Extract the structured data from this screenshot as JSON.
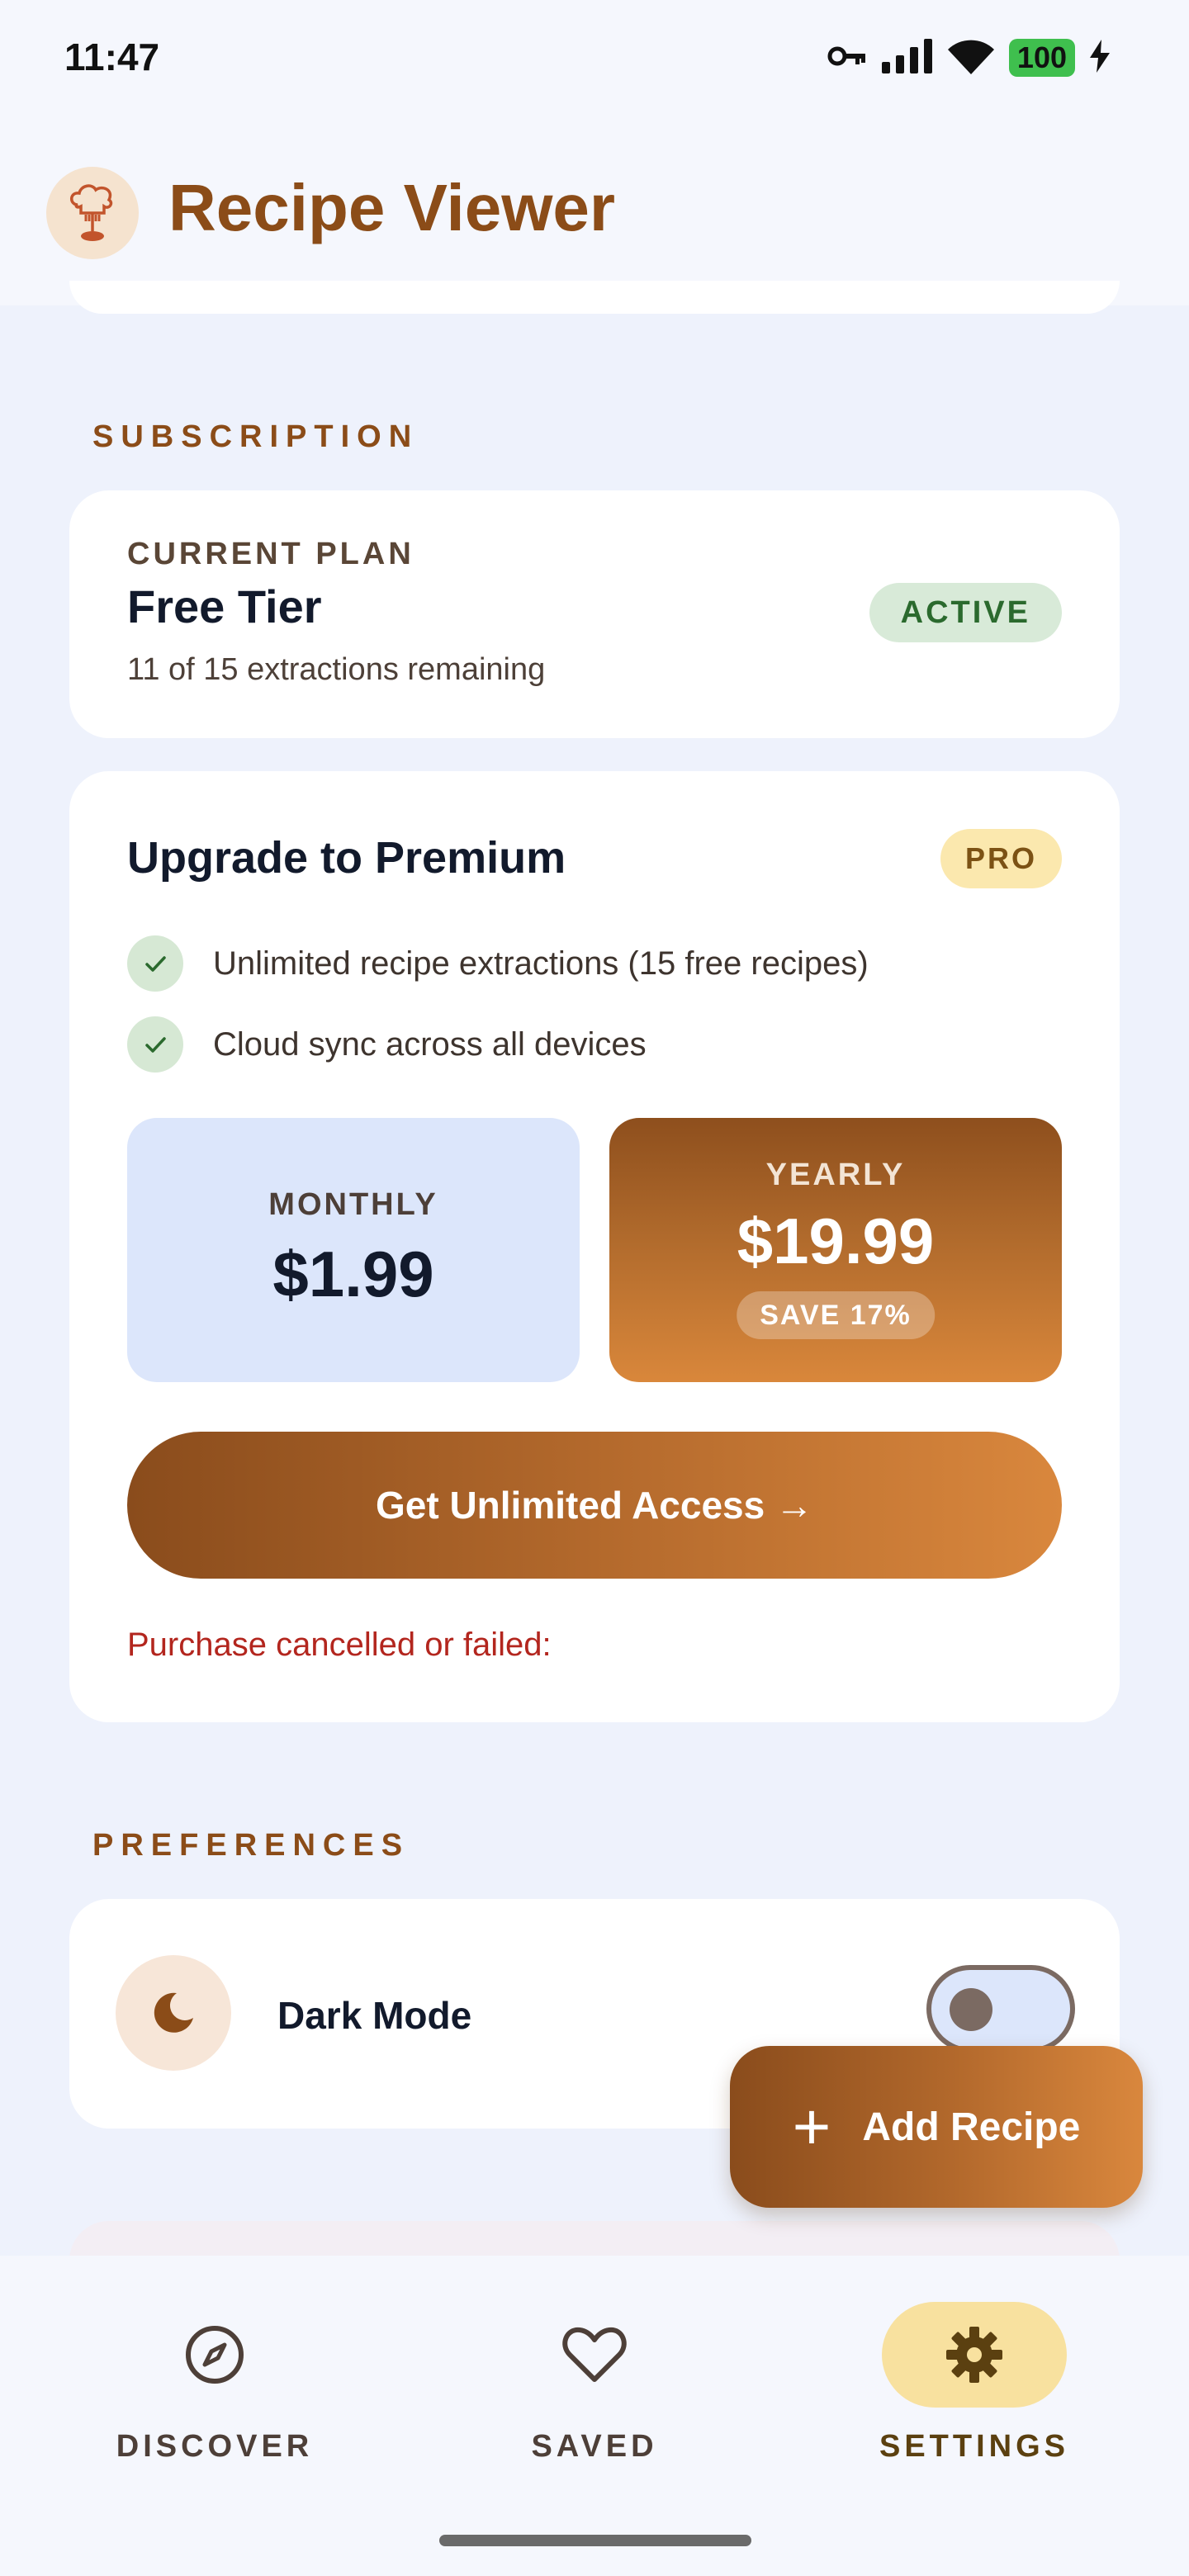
{
  "status_bar": {
    "time": "11:47",
    "battery": "100",
    "icons": [
      "key-icon",
      "signal-icon",
      "wifi-icon",
      "battery-charging-icon"
    ]
  },
  "app": {
    "title": "Recipe Viewer",
    "logo_icon": "chef-logo-icon"
  },
  "subscription": {
    "section_label": "SUBSCRIPTION",
    "current_plan": {
      "eyebrow": "CURRENT PLAN",
      "name": "Free Tier",
      "remaining": "11 of 15 extractions remaining",
      "status": "ACTIVE"
    },
    "upgrade": {
      "title": "Upgrade to Premium",
      "badge": "PRO",
      "features": [
        "Unlimited recipe extractions (15 free recipes)",
        "Cloud sync across all devices"
      ],
      "monthly": {
        "label": "MONTHLY",
        "price": "$1.99"
      },
      "yearly": {
        "label": "YEARLY",
        "price": "$19.99",
        "save": "SAVE 17%"
      },
      "cta": "Get Unlimited Access →",
      "error": "Purchase cancelled or failed:"
    }
  },
  "preferences": {
    "section_label": "PREFERENCES",
    "dark_mode": {
      "label": "Dark Mode",
      "enabled": false
    }
  },
  "fab": {
    "plus": "+",
    "label": "Add Recipe"
  },
  "nav": {
    "items": [
      {
        "label": "DISCOVER",
        "icon": "compass-icon",
        "active": false
      },
      {
        "label": "SAVED",
        "icon": "heart-icon",
        "active": false
      },
      {
        "label": "SETTINGS",
        "icon": "gear-icon",
        "active": true
      }
    ]
  },
  "colors": {
    "brand": "#8b4c18",
    "brand_light": "#d9873d",
    "background": "#eef2fc",
    "success_bg": "#d8ead8",
    "error": "#b3261e"
  }
}
